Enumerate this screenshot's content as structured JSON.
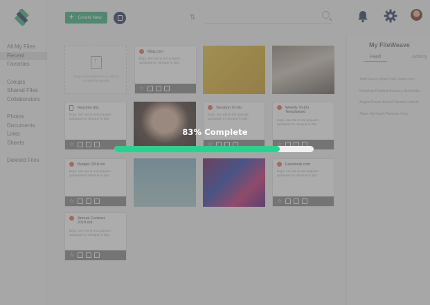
{
  "sidebar": {
    "items": [
      {
        "label": "All My Files"
      },
      {
        "label": "Recent",
        "active": true
      },
      {
        "label": "Favorites"
      },
      {
        "label": "Groups"
      },
      {
        "label": "Shared Files"
      },
      {
        "label": "Collaborators"
      },
      {
        "label": "Photos"
      },
      {
        "label": "Documents"
      },
      {
        "label": "Links"
      },
      {
        "label": "Sheets"
      },
      {
        "label": "Deleted Files"
      }
    ]
  },
  "toolbar": {
    "create_label": "Create New",
    "search_placeholder": ""
  },
  "cards": [
    {
      "name": "Blog.com",
      "desc": "Ergo, nec est in est unquam quisquam in utroque in dijo."
    },
    {
      "name": "Resume.doc",
      "desc": "Ergo, nec est in est unquam quisquam in utroque in dijo."
    },
    {
      "name": "Vacation To-Do",
      "desc": "Ergo, nec est in est unquam quisquam in utroque in dijo."
    },
    {
      "name": "Weekly To-Do Templatewd",
      "desc": "Ergo, nec est in est unquam quisquam in utroque in dijo."
    },
    {
      "name": "Budget 2018.xls",
      "desc": "Ergo, nec est in est unquam quisquam in utroque in dijo."
    },
    {
      "name": "Facebook.com",
      "desc": "Ergo, nec est in est unquam quisquam in utroque in dijo."
    },
    {
      "name": "Annual Contract 2018.dot",
      "desc": "Ergo, nec est in est unquam quisquam in utroque in dijo."
    }
  ],
  "upload": {
    "text": "Drag & drop files here or click to browse for uploads"
  },
  "panel": {
    "title": "My FileWeave",
    "tabs": [
      "Feed",
      "Activity"
    ],
    "feed": [
      "Todd Saxon joined Todo Saves.com",
      "Ninnahan Pastford shared a New folder",
      "Angela Duvak deleted Vacation and all",
      "Adam Hal Harris Revision 4.doc"
    ]
  },
  "progress": {
    "label": "83% Complete",
    "percent": 83
  },
  "colors": {
    "accent": "#27d38e",
    "brand": "#48b78a",
    "navy": "#3b4a6b"
  }
}
